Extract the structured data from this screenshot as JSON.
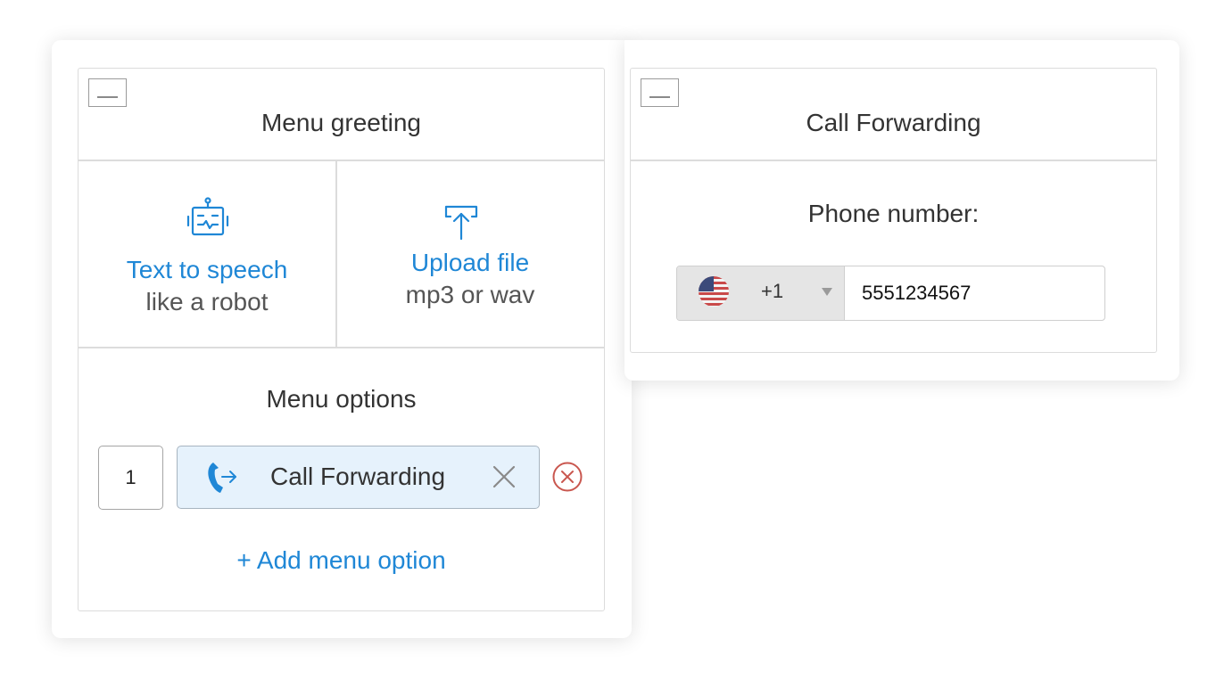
{
  "menu_card": {
    "title": "Menu greeting",
    "collapse_icon": "minus-box-icon",
    "choices": [
      {
        "title": "Text to speech",
        "subtitle": "like a robot",
        "icon": "robot-icon"
      },
      {
        "title": "Upload file",
        "subtitle": "mp3 or wav",
        "icon": "upload-icon"
      }
    ],
    "options_title": "Menu options",
    "options": [
      {
        "number": "1",
        "label": "Call Forwarding",
        "icon": "phone-forward-icon"
      }
    ],
    "add_option_label": "+ Add menu option"
  },
  "forward_card": {
    "title": "Call Forwarding",
    "collapse_icon": "minus-box-icon",
    "phone_label": "Phone number:",
    "country": {
      "flag": "us-flag-icon",
      "dial_code": "+1"
    },
    "phone_value": "5551234567"
  },
  "colors": {
    "accent": "#1f87d6",
    "option_bg": "#e6f2fc",
    "remove_red": "#c9574f",
    "border": "#dcdcdc"
  }
}
